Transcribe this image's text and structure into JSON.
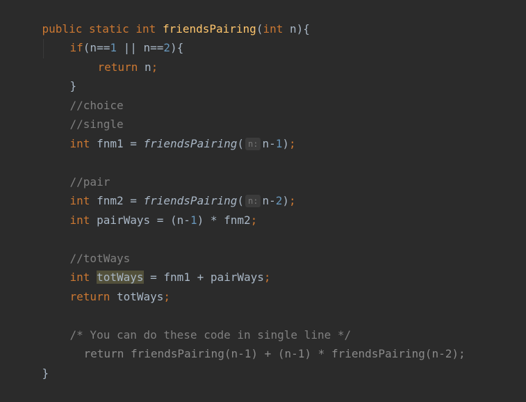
{
  "code": {
    "l1": {
      "kw1": "public",
      "kw2": "static",
      "kw3": "int",
      "fn": "friendsPairing",
      "open": "(",
      "kw4": "int",
      "param": "n",
      "close": "){"
    },
    "l2": {
      "kw": "if",
      "open": "(n==",
      "n1": "1",
      "or": " || n==",
      "n2": "2",
      "close": "){"
    },
    "l3": {
      "kw": "return",
      "rest": " n",
      "semi": ";"
    },
    "l4": {
      "brace": "}"
    },
    "l5": {
      "comment": "//choice"
    },
    "l6": {
      "comment": "//single"
    },
    "l7": {
      "kw": "int",
      "var": " fnm1 = ",
      "fn": "friendsPairing",
      "open": "(",
      "hint": "n:",
      "arg": "n-",
      "num": "1",
      "close": ")",
      "semi": ";"
    },
    "l8": {
      "comment": "//pair"
    },
    "l9": {
      "kw": "int",
      "var": " fnm2 = ",
      "fn": "friendsPairing",
      "open": "(",
      "hint": "n:",
      "arg": "n-",
      "num": "2",
      "close": ")",
      "semi": ";"
    },
    "l10": {
      "kw": "int",
      "var": " pairWays = (n-",
      "num": "1",
      "rest": ") * fnm2",
      "semi": ";"
    },
    "l11": {
      "comment": "//totWays"
    },
    "l12": {
      "kw": "int",
      "sp": " ",
      "var": "totWays",
      "rest": " = fnm1 + pairWays",
      "semi": ";"
    },
    "l13": {
      "kw": "return",
      "rest": " totWays",
      "semi": ";"
    },
    "l14": {
      "comment": "/* You can do these code in single line */"
    },
    "l15": {
      "text": "return friendsPairing(n-1) + (n-1) * friendsPairing(n-2);"
    },
    "l16": {
      "brace": "}"
    }
  }
}
